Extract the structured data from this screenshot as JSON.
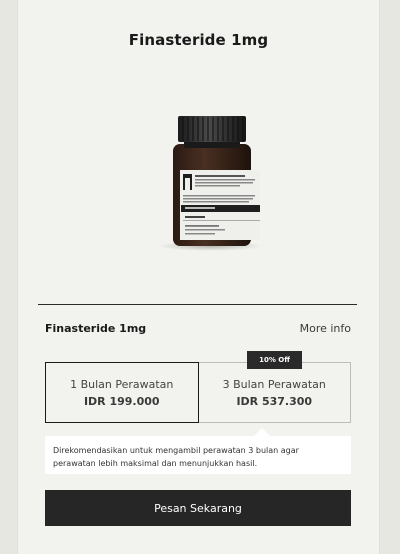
{
  "header": {
    "title": "Finasteride 1mg"
  },
  "product": {
    "name": "Finasteride 1mg",
    "more_info_label": "More info",
    "bottle_label": {
      "line1": "Apotik Mau",
      "line2": "Jalan Daruqi Tebet No. 102 1 RT. 8 RW...",
      "line3": "Tebet Barang, Jakarta Timur...",
      "line4": "No. Resep Apt Bttle ...",
      "line5": "Tanggal: 19 Dec 2020",
      "line6": "John Doe",
      "line7": "Finasteride 1mg",
      "line8": "Tiap sehari sesudah makan",
      "line9": "Jumlah: 28 Kapsul"
    }
  },
  "options": [
    {
      "label": "1 Bulan Perawatan",
      "price": "IDR 199.000",
      "selected": true
    },
    {
      "label": "3 Bulan Perawatan",
      "price": "IDR 537.300",
      "selected": false,
      "badge": "10% Off"
    }
  ],
  "recommendation": "Direkomendasikan untuk mengambil perawatan 3 bulan agar perawatan lebih maksimal dan menunjukkan hasil.",
  "cta_label": "Pesan Sekarang",
  "colors": {
    "background": "#e7e7e1",
    "card": "#f2f2ee",
    "dark": "#262626"
  }
}
